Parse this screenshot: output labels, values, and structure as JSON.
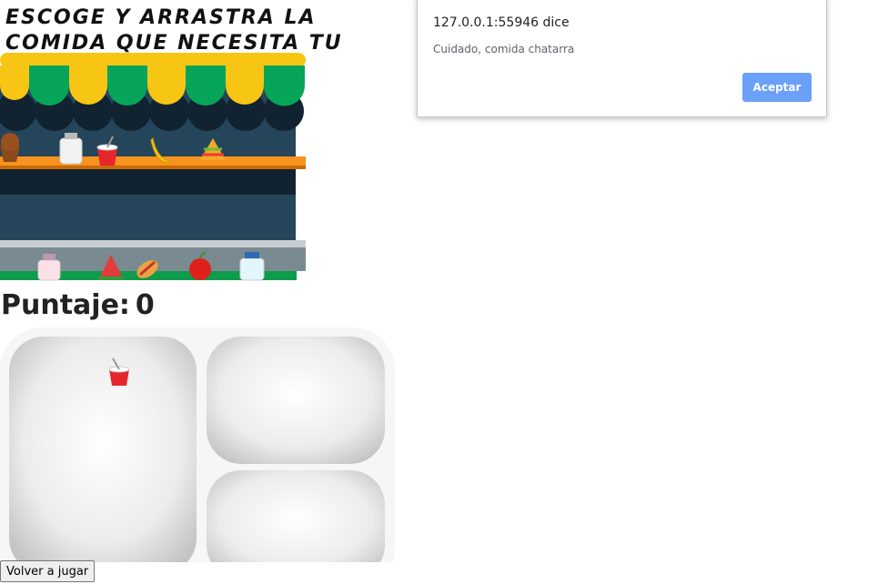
{
  "header": {
    "title": "Escoge y arrastra la comida que necesita tu cuerpo"
  },
  "score": {
    "label": "Puntaje:",
    "value": "0"
  },
  "shelf": {
    "top_items": [
      "cupcake-icon",
      "milk-bottle-icon",
      "soda-cup-icon",
      "banana-icon",
      "sandwich-icon"
    ],
    "bottom_items": [
      "strawberry-milk-icon",
      "watermelon-icon",
      "hotdog-icon",
      "apple-icon",
      "milk-bottle-icon"
    ]
  },
  "tray": {
    "dropped_items": [
      "soda-cup-icon"
    ]
  },
  "controls": {
    "replay_label": "Volver a jugar"
  },
  "alert": {
    "title": "127.0.0.1:55946 dice",
    "message": "Cuidado, comida chatarra",
    "ok_label": "Aceptar"
  }
}
